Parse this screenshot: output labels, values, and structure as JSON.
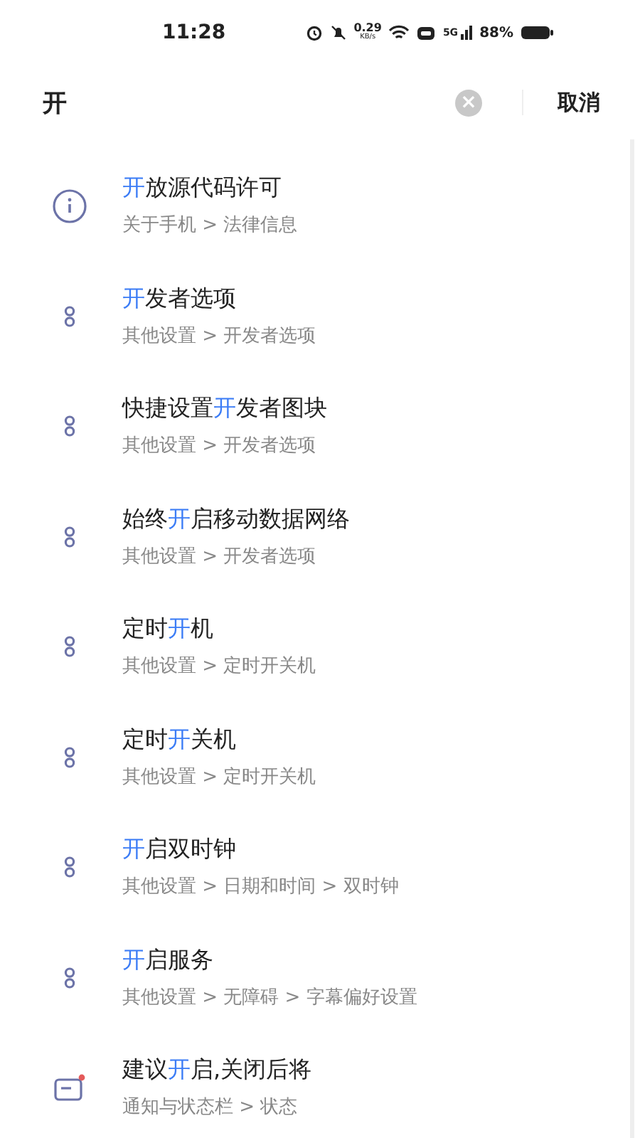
{
  "status_bar": {
    "time": "11:28",
    "speed": "0.29",
    "speed_unit": "KB/s",
    "network": "5G",
    "battery": "88%"
  },
  "search": {
    "value": "开",
    "clear": "×",
    "cancel": "取消"
  },
  "results": [
    {
      "kind": "info",
      "title": {
        "hit": "开",
        "post": "放源代码许可"
      },
      "path": "关于手机 > 法律信息"
    },
    {
      "kind": "dots",
      "title": {
        "hit": "开",
        "post": "发者选项"
      },
      "path": "其他设置 > 开发者选项"
    },
    {
      "kind": "dots",
      "title": {
        "pre": "快捷设置",
        "hit": "开",
        "post": "发者图块"
      },
      "path": "其他设置 > 开发者选项"
    },
    {
      "kind": "dots",
      "title": {
        "pre": "始终",
        "hit": "开",
        "post": "启移动数据网络"
      },
      "path": "其他设置 > 开发者选项"
    },
    {
      "kind": "dots",
      "title": {
        "pre": "定时",
        "hit": "开",
        "post": "机"
      },
      "path": "其他设置 > 定时开关机"
    },
    {
      "kind": "dots",
      "title": {
        "pre": "定时",
        "hit": "开",
        "post": "关机"
      },
      "path": "其他设置 > 定时开关机"
    },
    {
      "kind": "dots",
      "title": {
        "hit": "开",
        "post": "启双时钟"
      },
      "path": "其他设置 > 日期和时间 > 双时钟"
    },
    {
      "kind": "dots",
      "title": {
        "hit": "开",
        "post": "启服务"
      },
      "path": "其他设置 > 无障碍 > 字幕偏好设置"
    },
    {
      "kind": "notice",
      "title": {
        "pre": "建议",
        "hit": "开",
        "post": "启,关闭后将"
      },
      "path": "通知与状态栏 > 状态"
    }
  ]
}
